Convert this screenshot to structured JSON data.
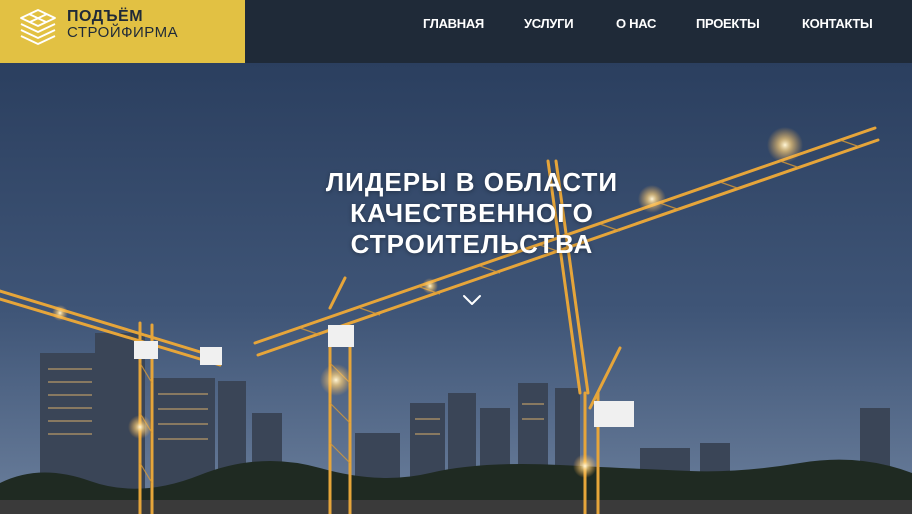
{
  "logo": {
    "line1": "ПОДЪЁМ",
    "line2": "СТРОЙФИРМА",
    "icon": "stacked-layers-icon"
  },
  "nav": {
    "items": [
      {
        "label": "ГЛАВНАЯ"
      },
      {
        "label": "УСЛУГИ"
      },
      {
        "label": "О НАС"
      },
      {
        "label": "ПРОЕКТЫ"
      },
      {
        "label": "КОНТАКТЫ"
      }
    ]
  },
  "hero": {
    "title_lines": [
      "ЛИДЕРЫ В ОБЛАСТИ",
      "КАЧЕСТВЕННОГО",
      "СТРОИТЕЛЬСТВА"
    ],
    "scroll_icon": "chevron-down-icon"
  },
  "colors": {
    "header_bg": "#1f2a38",
    "logo_bg": "#e2c143",
    "nav_text": "#ffffff",
    "crane": "#e6a53a",
    "sky_top": "#2b3f5f",
    "sky_bottom": "#6b7f9c"
  }
}
